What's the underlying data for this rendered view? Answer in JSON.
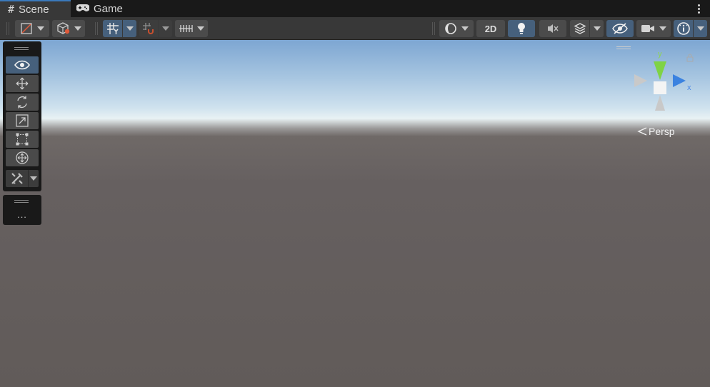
{
  "tabs": [
    {
      "label": "Scene",
      "icon": "grid-hash-icon",
      "active": true
    },
    {
      "label": "Game",
      "icon": "gamepad-icon",
      "active": false
    }
  ],
  "toolbar": {
    "left_groups": [
      "draw-mode-icon",
      "shading-cube-icon",
      "grid-snap-icon",
      "increment-snap-icon",
      "grid-ruler-icon"
    ],
    "right_groups": [
      "render-sphere-icon",
      "2d-toggle",
      "lighting-bulb-icon",
      "audio-mute-icon",
      "effects-layers-icon",
      "visibility-eye-icon",
      "camera-icon",
      "gizmos-info-icon"
    ],
    "toggle_2d_label": "2D"
  },
  "overlay_tools": [
    "view-tool-eye-icon",
    "move-tool-icon",
    "rotate-tool-icon",
    "scale-tool-icon",
    "rect-tool-icon",
    "transform-tool-icon",
    "custom-tools-icon"
  ],
  "overlay_more_label": "...",
  "gizmo": {
    "y_label": "y",
    "x_label": "x",
    "projection_label": "Persp"
  },
  "colors": {
    "accent": "#3a79bb",
    "active_button": "#46607c",
    "y_axis": "#7fd344",
    "x_axis": "#3b82e0",
    "sky_top": "#7da6d2",
    "ground": "#615b59"
  }
}
